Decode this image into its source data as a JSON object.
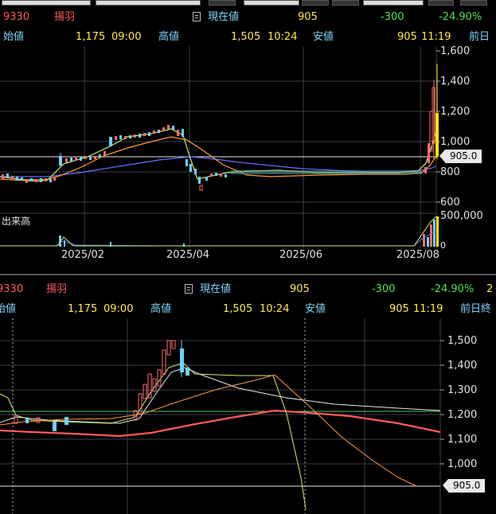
{
  "stock": {
    "code": "9330",
    "name": "揚羽"
  },
  "quote": {
    "current_label": "現在値",
    "current_price": "905",
    "change": "-300",
    "change_pct": "-24.90%",
    "open_label": "始値",
    "open_value": "1,175",
    "open_time": "09:00",
    "high_label": "高値",
    "high_value": "1,505",
    "high_time": "10:24",
    "low_label": "安値",
    "low_value": "905",
    "low_time": "11:19",
    "prev_label_top": "前日",
    "prev_label_bottom": "前日終",
    "extra_bottom": "2"
  },
  "top_chart": {
    "price_ticks": [
      "1,600",
      "1,400",
      "1,200",
      "1,000",
      "800",
      "600"
    ],
    "volume_label": "出来高",
    "volume_tick": "500,000",
    "volume_zero": "0",
    "date_labels": [
      "2025/02",
      "2025/04",
      "2025/06",
      "2025/08"
    ],
    "current_tag": "905.0"
  },
  "bottom_chart": {
    "price_ticks": [
      "1,500",
      "1,400",
      "1,300",
      "1,200",
      "1,100",
      "1,000"
    ],
    "current_tag": "905.0"
  },
  "colors": {
    "up": "#ff6b6b",
    "down": "#6fd0ff",
    "ma_short": "#c9f07a",
    "ma_mid": "#ff9a3c",
    "ma_long": "#6b6bff",
    "accent_bar": "#ffe600"
  }
}
